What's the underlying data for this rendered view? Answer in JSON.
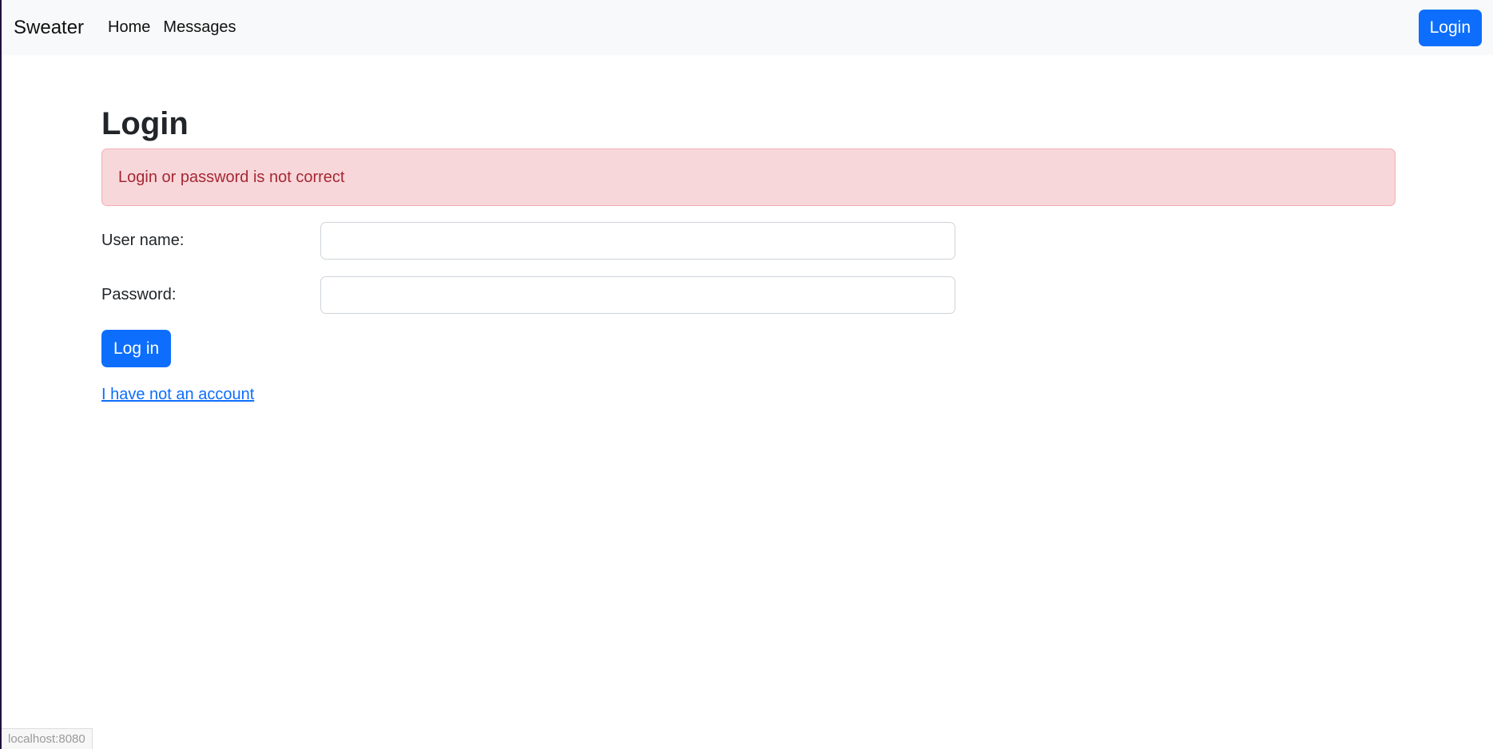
{
  "navbar": {
    "brand": "Sweater",
    "links": [
      {
        "label": "Home"
      },
      {
        "label": "Messages"
      }
    ],
    "login_button": "Login"
  },
  "main": {
    "title": "Login",
    "error_alert": "Login or password is not correct",
    "username_label": "User name:",
    "username_value": "",
    "password_label": "Password:",
    "password_value": "",
    "submit_label": "Log in",
    "register_link": "I have not an account"
  },
  "status_bar": {
    "url": "localhost:8080"
  },
  "colors": {
    "primary": "#0d6efd",
    "navbar_bg": "#f8f9fa",
    "alert_bg": "#f8d7da",
    "alert_text": "#a52834"
  }
}
